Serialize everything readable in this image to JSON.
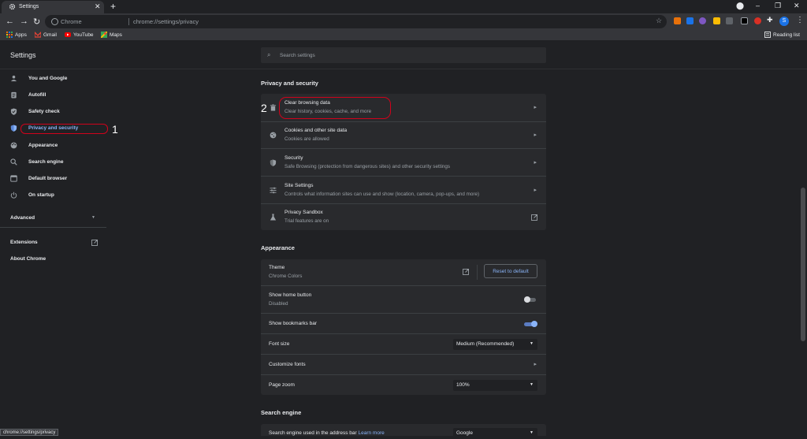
{
  "browser": {
    "tab_title": "Settings",
    "omnibox_chip": "Chrome",
    "url": "chrome://settings/privacy",
    "profile_initial": "S",
    "reading_list": "Reading list"
  },
  "bookmarks": [
    {
      "label": "Apps",
      "icon": "apps-grid-icon"
    },
    {
      "label": "Gmail",
      "icon": "gmail-icon"
    },
    {
      "label": "YouTube",
      "icon": "youtube-icon"
    },
    {
      "label": "Maps",
      "icon": "maps-icon"
    }
  ],
  "settings": {
    "title": "Settings",
    "search_placeholder": "Search settings"
  },
  "sidebar": {
    "items": [
      {
        "label": "You and Google",
        "icon": "person-icon"
      },
      {
        "label": "Autofill",
        "icon": "clipboard-icon"
      },
      {
        "label": "Safety check",
        "icon": "shield-check-icon"
      },
      {
        "label": "Privacy and security",
        "icon": "shield-icon",
        "active": true
      },
      {
        "label": "Appearance",
        "icon": "palette-icon"
      },
      {
        "label": "Search engine",
        "icon": "search-icon"
      },
      {
        "label": "Default browser",
        "icon": "browser-icon"
      },
      {
        "label": "On startup",
        "icon": "power-icon"
      }
    ],
    "advanced": "Advanced",
    "extensions": "Extensions",
    "about": "About Chrome"
  },
  "privacy": {
    "title": "Privacy and security",
    "rows": [
      {
        "title": "Clear browsing data",
        "subtitle": "Clear history, cookies, cache, and more",
        "icon": "trash-icon"
      },
      {
        "title": "Cookies and other site data",
        "subtitle": "Cookies are allowed",
        "icon": "cookie-icon"
      },
      {
        "title": "Security",
        "subtitle": "Safe Browsing (protection from dangerous sites) and other security settings",
        "icon": "security-shield-icon"
      },
      {
        "title": "Site Settings",
        "subtitle": "Controls what information sites can use and show (location, camera, pop-ups, and more)",
        "icon": "sliders-icon"
      },
      {
        "title": "Privacy Sandbox",
        "subtitle": "Trial features are on",
        "icon": "flask-icon"
      }
    ]
  },
  "appearance": {
    "title": "Appearance",
    "theme_title": "Theme",
    "theme_subtitle": "Chrome Colors",
    "reset_label": "Reset to default",
    "home_title": "Show home button",
    "home_subtitle": "Disabled",
    "home_on": false,
    "bookmarks_bar_title": "Show bookmarks bar",
    "bookmarks_bar_on": true,
    "font_size_title": "Font size",
    "font_size_value": "Medium (Recommended)",
    "customize_fonts": "Customize fonts",
    "zoom_title": "Page zoom",
    "zoom_value": "100%"
  },
  "search_engine": {
    "title": "Search engine",
    "row_title": "Search engine used in the address bar",
    "learn_more": "Learn more",
    "value": "Google"
  },
  "status_url": "chrome://settings/privacy",
  "annotations": {
    "one": "1",
    "two": "2"
  },
  "colors": {
    "accent": "#8ab4f8",
    "annotation": "#d0021b",
    "background": "#202124",
    "card": "#292a2d"
  }
}
